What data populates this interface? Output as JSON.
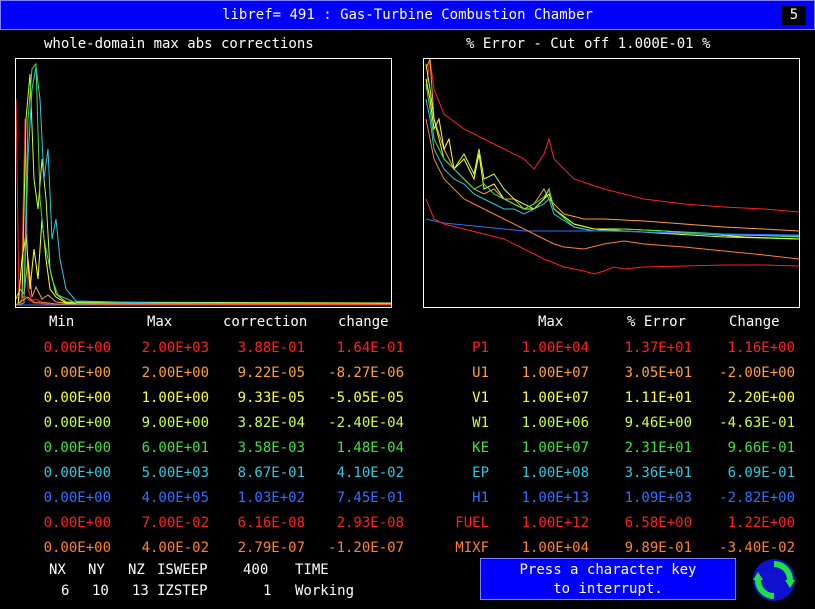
{
  "header": {
    "title": "libref= 491 : Gas-Turbine Combustion Chamber",
    "badge": "5"
  },
  "left_plot": {
    "title": "whole-domain max abs corrections"
  },
  "right_plot": {
    "title": "% Error - Cut off 1.000E-01 %"
  },
  "left_table": {
    "headers": {
      "min": "Min",
      "max": "Max",
      "correction": "correction",
      "change": "change"
    },
    "rows": [
      {
        "min": "0.00E+00",
        "max": "2.00E+03",
        "correction": "3.88E-01",
        "change": "1.64E-01",
        "color": "#ff2020"
      },
      {
        "min": "0.00E+00",
        "max": "2.00E+00",
        "correction": "9.22E-05",
        "change": "-8.27E-06",
        "color": "#ffa030"
      },
      {
        "min": "0.00E+00",
        "max": "1.00E+00",
        "correction": "9.33E-05",
        "change": "-5.05E-05",
        "color": "#ffff30"
      },
      {
        "min": "0.00E+00",
        "max": "9.00E+00",
        "correction": "3.82E-04",
        "change": "-2.40E-04",
        "color": "#c8ff40"
      },
      {
        "min": "0.00E+00",
        "max": "6.00E+01",
        "correction": "3.58E-03",
        "change": "1.48E-04",
        "color": "#40e040"
      },
      {
        "min": "0.00E+00",
        "max": "5.00E+03",
        "correction": "8.67E-01",
        "change": "4.10E-02",
        "color": "#30c8e0"
      },
      {
        "min": "0.00E+00",
        "max": "4.00E+05",
        "correction": "1.03E+02",
        "change": "7.45E-01",
        "color": "#3070ff"
      },
      {
        "min": "0.00E+00",
        "max": "7.00E-02",
        "correction": "6.16E-08",
        "change": "2.93E-08",
        "color": "#ff2020"
      },
      {
        "min": "0.00E+00",
        "max": "4.00E-02",
        "correction": "2.79E-07",
        "change": "-1.20E-07",
        "color": "#ff8030"
      }
    ]
  },
  "right_table": {
    "headers": {
      "max": "Max",
      "error": "% Error",
      "change": "Change"
    },
    "rows": [
      {
        "var": "P1",
        "max": "1.00E+04",
        "error": "1.37E+01",
        "change": "1.16E+00",
        "color": "#ff2020"
      },
      {
        "var": "U1",
        "max": "1.00E+07",
        "error": "3.05E+01",
        "change": "-2.00E+00",
        "color": "#ffa030"
      },
      {
        "var": "V1",
        "max": "1.00E+07",
        "error": "1.11E+01",
        "change": "2.20E+00",
        "color": "#ffff30"
      },
      {
        "var": "W1",
        "max": "1.00E+06",
        "error": "9.46E+00",
        "change": "-4.63E-01",
        "color": "#c8ff40"
      },
      {
        "var": "KE",
        "max": "1.00E+07",
        "error": "2.31E+01",
        "change": "9.66E-01",
        "color": "#40e040"
      },
      {
        "var": "EP",
        "max": "1.00E+08",
        "error": "3.36E+01",
        "change": "6.09E-01",
        "color": "#30c8e0"
      },
      {
        "var": "H1",
        "max": "1.00E+13",
        "error": "1.09E+03",
        "change": "-2.82E+00",
        "color": "#3070ff"
      },
      {
        "var": "FUEL",
        "max": "1.00E+12",
        "error": "6.58E+00",
        "change": "1.22E+00",
        "color": "#ff2020"
      },
      {
        "var": "MIXF",
        "max": "1.00E+04",
        "error": "9.89E-01",
        "change": "-3.40E-02",
        "color": "#ff8030"
      }
    ]
  },
  "footer": {
    "nx_label": "NX",
    "ny_label": "NY",
    "nz_label": "NZ",
    "isweep_label": "ISWEEP",
    "isweep_value": "400",
    "time_label": "TIME",
    "nx_value": "6",
    "ny_value": "10",
    "nz_value": "13",
    "izstep_label": "IZSTEP",
    "izstep_value": "1",
    "status": "Working"
  },
  "message": {
    "line1": "Press a character key",
    "line2": "to interrupt."
  },
  "icons": {
    "refresh": "refresh-icon"
  }
}
